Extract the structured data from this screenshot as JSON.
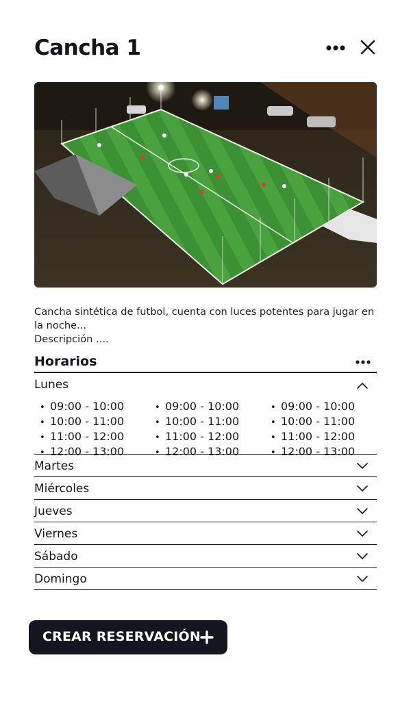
{
  "header": {
    "title": "Cancha 1",
    "more_icon": "more-horizontal-icon",
    "close_icon": "close-icon"
  },
  "image": {
    "description": "Aerial night view of lit synthetic soccer field"
  },
  "description": {
    "line1": "Cancha sintética de futbol, cuenta con luces potentes para jugar en la noche...",
    "line2": "Descripción ...."
  },
  "schedule": {
    "title": "Horarios",
    "days": [
      {
        "label": "Lunes",
        "expanded": true,
        "columns": [
          [
            "09:00 - 10:00",
            "10:00 - 11:00",
            "11:00 - 12:00",
            "12:00 - 13:00"
          ],
          [
            "09:00 - 10:00",
            "10:00 - 11:00",
            "11:00 - 12:00",
            "12:00 - 13:00"
          ],
          [
            "09:00 - 10:00",
            "10:00 - 11:00",
            "11:00 - 12:00",
            "12:00 - 13:00"
          ]
        ]
      },
      {
        "label": "Martes",
        "expanded": false
      },
      {
        "label": "Miércoles",
        "expanded": false
      },
      {
        "label": "Jueves",
        "expanded": false
      },
      {
        "label": "Viernes",
        "expanded": false
      },
      {
        "label": "Sábado",
        "expanded": false
      },
      {
        "label": "Domingo",
        "expanded": false
      }
    ]
  },
  "cta": {
    "label": "CREAR RESERVACIÓN",
    "icon": "plus-icon"
  },
  "colors": {
    "primary": "#15151f",
    "background": "#ffffff",
    "field_green": "#3f9a3a"
  }
}
